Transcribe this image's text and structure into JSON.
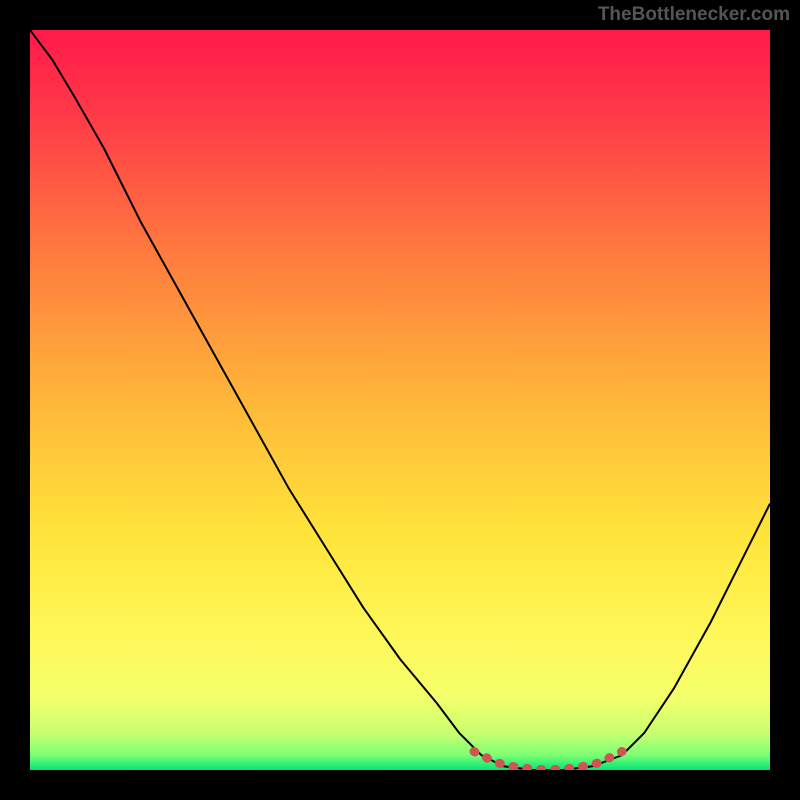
{
  "watermark": "TheBottlenecker.com",
  "chart_data": {
    "type": "line",
    "title": "",
    "xlabel": "",
    "ylabel": "",
    "xlim": [
      0,
      100
    ],
    "ylim": [
      0,
      100
    ],
    "grid": false,
    "background_gradient": {
      "top": "#ff1744",
      "mid_upper": "#ff7043",
      "mid": "#ffd740",
      "mid_lower": "#ffee58",
      "bottom": "#00e676"
    },
    "series": [
      {
        "name": "bottleneck-curve",
        "color": "#000000",
        "stroke_width": 2,
        "points": [
          {
            "x": 0,
            "y": 100
          },
          {
            "x": 3,
            "y": 96
          },
          {
            "x": 6,
            "y": 91
          },
          {
            "x": 10,
            "y": 84
          },
          {
            "x": 15,
            "y": 74
          },
          {
            "x": 20,
            "y": 65
          },
          {
            "x": 25,
            "y": 56
          },
          {
            "x": 30,
            "y": 47
          },
          {
            "x": 35,
            "y": 38
          },
          {
            "x": 40,
            "y": 30
          },
          {
            "x": 45,
            "y": 22
          },
          {
            "x": 50,
            "y": 15
          },
          {
            "x": 55,
            "y": 9
          },
          {
            "x": 58,
            "y": 5
          },
          {
            "x": 61,
            "y": 2
          },
          {
            "x": 64,
            "y": 0.5
          },
          {
            "x": 68,
            "y": 0
          },
          {
            "x": 72,
            "y": 0
          },
          {
            "x": 76,
            "y": 0.5
          },
          {
            "x": 80,
            "y": 2
          },
          {
            "x": 83,
            "y": 5
          },
          {
            "x": 87,
            "y": 11
          },
          {
            "x": 92,
            "y": 20
          },
          {
            "x": 96,
            "y": 28
          },
          {
            "x": 100,
            "y": 36
          }
        ]
      },
      {
        "name": "optimal-zone-marker",
        "color": "#d9534f",
        "stroke_width": 8,
        "stroke_linecap": "round",
        "stroke_dasharray": "2 10",
        "points": [
          {
            "x": 60,
            "y": 2.5
          },
          {
            "x": 63,
            "y": 1
          },
          {
            "x": 66,
            "y": 0.3
          },
          {
            "x": 70,
            "y": 0
          },
          {
            "x": 74,
            "y": 0.3
          },
          {
            "x": 77,
            "y": 1
          },
          {
            "x": 80,
            "y": 2.5
          }
        ]
      }
    ]
  }
}
